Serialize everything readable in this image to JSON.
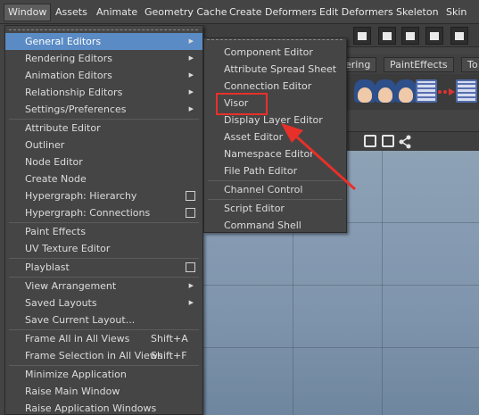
{
  "menubar": {
    "items": [
      "Window",
      "Assets",
      "Animate",
      "Geometry Cache",
      "Create Deformers",
      "Edit Deformers",
      "Skeleton",
      "Skin"
    ]
  },
  "shelf_tabs": [
    "ering",
    "PaintEffects",
    "To"
  ],
  "window_menu": {
    "items": [
      {
        "label": "General Editors",
        "submenu": true
      },
      {
        "label": "Rendering Editors",
        "submenu": true
      },
      {
        "label": "Animation Editors",
        "submenu": true
      },
      {
        "label": "Relationship Editors",
        "submenu": true
      },
      {
        "label": "Settings/Preferences",
        "submenu": true
      },
      {
        "label": "Attribute Editor"
      },
      {
        "label": "Outliner"
      },
      {
        "label": "Node Editor"
      },
      {
        "label": "Create Node"
      },
      {
        "label": "Hypergraph: Hierarchy",
        "option_box": true
      },
      {
        "label": "Hypergraph: Connections",
        "option_box": true
      },
      {
        "label": "Paint Effects"
      },
      {
        "label": "UV Texture Editor"
      },
      {
        "label": "Playblast",
        "option_box": true
      },
      {
        "label": "View Arrangement",
        "submenu": true
      },
      {
        "label": "Saved Layouts",
        "submenu": true
      },
      {
        "label": "Save Current Layout..."
      },
      {
        "label": "Frame All in All Views",
        "shortcut": "Shift+A"
      },
      {
        "label": "Frame Selection in All Views",
        "shortcut": "Shift+F"
      },
      {
        "label": "Minimize Application"
      },
      {
        "label": "Raise Main Window"
      },
      {
        "label": "Raise Application Windows"
      }
    ]
  },
  "general_editors_menu": {
    "items": [
      "Component Editor",
      "Attribute Spread Sheet",
      "Connection Editor",
      "Visor",
      "Display Layer Editor",
      "Asset Editor",
      "Namespace Editor",
      "File Path Editor",
      "Channel Control",
      "Script Editor",
      "Command Shell"
    ],
    "highlighted": "Visor"
  },
  "colors": {
    "menu_bg": "#454545",
    "highlight": "#5a8bc4",
    "annotation_red": "#e8302a"
  },
  "icons": {
    "submenu": "triangle-right-icon",
    "option_box": "option-box-icon"
  }
}
